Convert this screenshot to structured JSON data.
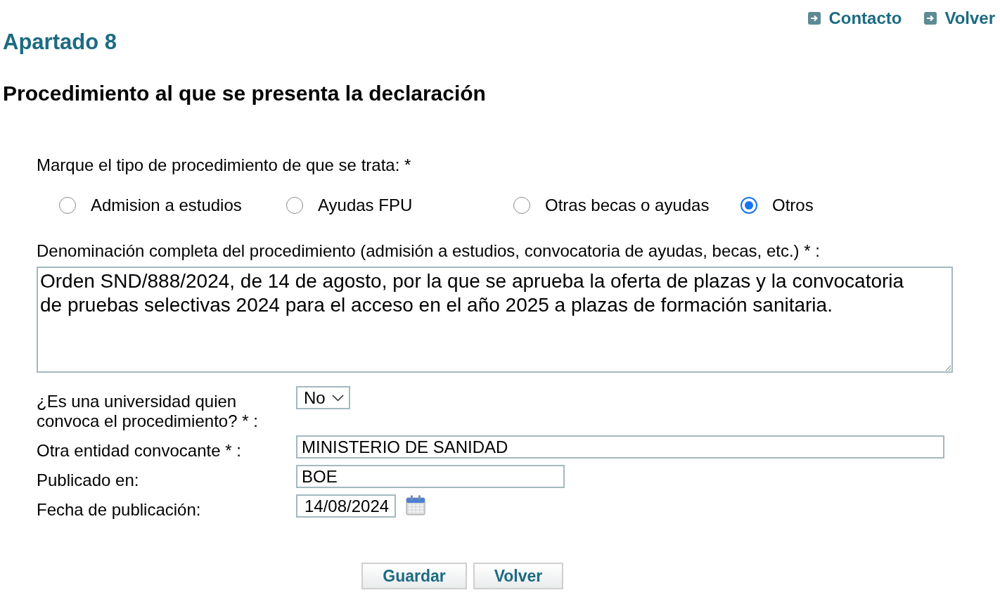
{
  "header_links": [
    {
      "label": "Contacto"
    },
    {
      "label": "Volver"
    }
  ],
  "section_title": "Apartado 8",
  "heading": "Procedimiento al que se presenta la declaración",
  "procedure_type": {
    "label": "Marque el tipo de procedimiento de que se trata: *",
    "options": [
      {
        "label": "Admision a estudios",
        "selected": false
      },
      {
        "label": "Ayudas FPU",
        "selected": false
      },
      {
        "label": "Otras becas o ayudas",
        "selected": false
      },
      {
        "label": "Otros",
        "selected": true
      }
    ]
  },
  "procedure_name": {
    "label": "Denominación completa del procedimiento (admisión a estudios, convocatoria de ayudas, becas, etc.) * :",
    "value": "Orden SND/888/2024, de 14 de agosto, por la que se aprueba la oferta de plazas y la convocatoria de pruebas selectivas 2024 para el acceso en el año 2025 a plazas de formación sanitaria."
  },
  "university_convenes": {
    "label": "¿Es una universidad quien convoca el procedimiento? * :",
    "value": "No"
  },
  "other_entity": {
    "label": "Otra entidad convocante * :",
    "value": "MINISTERIO DE SANIDAD"
  },
  "published_in": {
    "label": "Publicado en:",
    "value": "BOE"
  },
  "publication_date": {
    "label": "Fecha de publicación:",
    "value": "14/08/2024"
  },
  "buttons": [
    {
      "label": "Guardar"
    },
    {
      "label": "Volver"
    }
  ]
}
